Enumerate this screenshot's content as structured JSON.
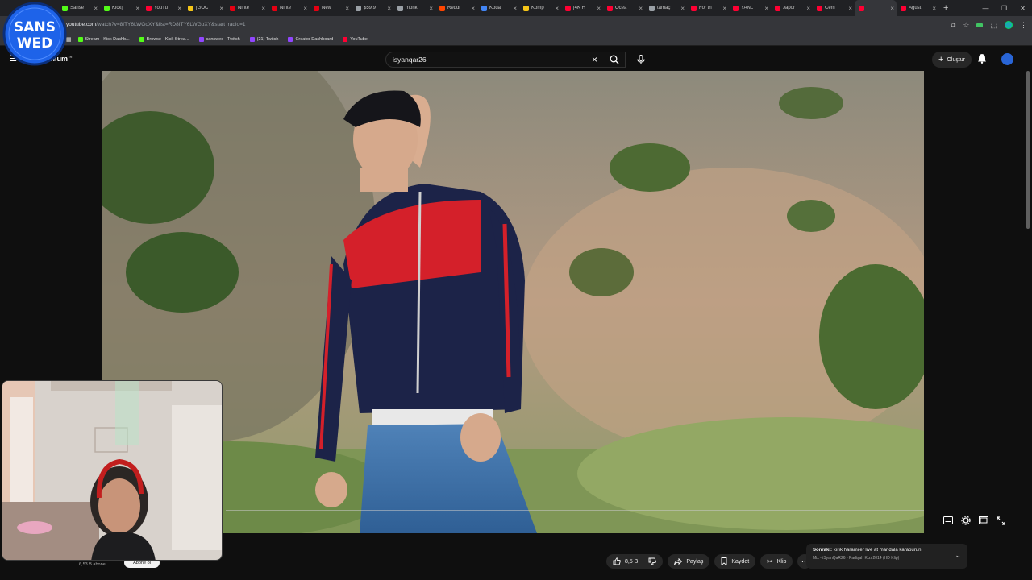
{
  "browser": {
    "tabs": [
      {
        "label": "Sanse",
        "color": "#53fc18"
      },
      {
        "label": "Kick|",
        "color": "#53fc18"
      },
      {
        "label": "YouTu",
        "color": "#ff0033"
      },
      {
        "label": "[GOC",
        "color": "#f5c518"
      },
      {
        "label": "Ninte",
        "color": "#e60012"
      },
      {
        "label": "Ninte",
        "color": "#e60012"
      },
      {
        "label": "New",
        "color": "#e60012"
      },
      {
        "label": "$59.9",
        "color": "#9aa0a6"
      },
      {
        "label": "monk",
        "color": "#9aa0a6"
      },
      {
        "label": "Reddi",
        "color": "#ff4500"
      },
      {
        "label": "Kodal",
        "color": "#4285f4"
      },
      {
        "label": "Komp",
        "color": "#f5c518"
      },
      {
        "label": "[4K H",
        "color": "#ff0033"
      },
      {
        "label": "Ocea",
        "color": "#ff0033"
      },
      {
        "label": "tamaç",
        "color": "#9aa0a6"
      },
      {
        "label": "For th",
        "color": "#ff0033"
      },
      {
        "label": "YANL",
        "color": "#ff0033"
      },
      {
        "label": "Japor",
        "color": "#ff0033"
      },
      {
        "label": "Cem",
        "color": "#ff0033"
      },
      {
        "label": "",
        "color": "#ff0033",
        "active": true
      },
      {
        "label": "Agust",
        "color": "#ff0033"
      }
    ],
    "new_tab_label": "+",
    "url_host": "youtube.com",
    "url_path": "/watch?v=8ITY6LWGoXY&list=RD8ITY6LWGoXY&start_radio=1",
    "bookmarks": [
      {
        "label": "Stream - Kick Dashb...",
        "color": "#53fc18"
      },
      {
        "label": "Browse - Kick Strea...",
        "color": "#53fc18"
      },
      {
        "label": "sanswed - Twitch",
        "color": "#9146ff"
      },
      {
        "label": "(21) Twitch",
        "color": "#9146ff"
      },
      {
        "label": "Creator Dashboard",
        "color": "#9146ff"
      },
      {
        "label": "YouTube",
        "color": "#ff0033"
      }
    ]
  },
  "channel_logo": {
    "line1": "SANS",
    "line2": "WED",
    "color": "#1e63e9"
  },
  "youtube": {
    "logo_text": "mium",
    "logo_sup": "TR",
    "search_value": "isyanqar26",
    "create_label": "Oluştur",
    "subscribers": "6,53 B abone",
    "subscribe_label": "Abone ol",
    "likes": "8,5 B",
    "share_label": "Paylaş",
    "save_label": "Kaydet",
    "clip_label": "Klip",
    "next_prefix": "Sonraki:",
    "next_title": "kırık haramiler live at mandala karaburun",
    "mix_subtitle": "Mix - iSyanQaR26 - Padişah Kızı 2014 (HD Klip)"
  },
  "colors": {
    "accent_red": "#ff0033",
    "background": "#0f0f0f"
  }
}
